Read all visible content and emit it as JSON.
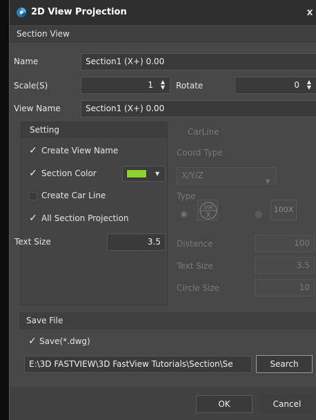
{
  "window": {
    "title": "2D View Projection",
    "close_label": "x"
  },
  "section_view": {
    "header": "Section View",
    "name_label": "Name",
    "name_value": "Section1 (X+) 0.00",
    "scale_label": "Scale(S)",
    "scale_value": "1",
    "rotate_label": "Rotate",
    "rotate_value": "0",
    "view_name_label": "View Name",
    "view_name_value": "Section1 (X+) 0.00"
  },
  "setting": {
    "header": "Setting",
    "create_view_name": {
      "label": "Create View Name",
      "checked": true
    },
    "section_color": {
      "label": "Section Color",
      "checked": true,
      "color": "#8dd130"
    },
    "create_car_line": {
      "label": "Create Car Line",
      "checked": false
    },
    "all_section_projection": {
      "label": "All Section Projection",
      "checked": true
    },
    "text_size_label": "Text Size",
    "text_size_value": "3.5"
  },
  "carline": {
    "header": "CarLine",
    "coord_type_label": "Coord Type",
    "coord_type_value": "X/Y/Z",
    "type_label": "Type",
    "type_icon_circle_text": "100",
    "type_icon_square_text": "100X",
    "distance_label": "Distance",
    "distance_value": "100",
    "text_size_label": "Text Size",
    "text_size_value": "3.5",
    "circle_size_label": "Circle Size",
    "circle_size_value": "10"
  },
  "save_file": {
    "header": "Save File",
    "save_label": "Save(*.dwg)",
    "save_checked": true,
    "path_value": "E:\\3D FASTVIEW\\3D FastView Tutorials\\Section\\Se",
    "search_label": "Search"
  },
  "footer": {
    "ok_label": "OK",
    "cancel_label": "Cancel"
  },
  "icons": {
    "app": "app-logo-icon",
    "check": "check-icon",
    "spin": "spin-arrows-icon",
    "dropdown": "chevron-down-icon"
  }
}
